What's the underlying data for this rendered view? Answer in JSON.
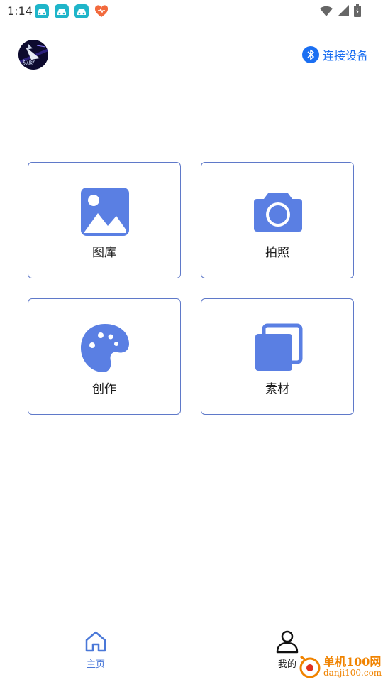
{
  "status_bar": {
    "time": "1:14",
    "notification_icons": [
      "car-app-icon",
      "car-app-icon",
      "car-app-icon",
      "heart-app-icon"
    ],
    "right_icons": [
      "wifi-icon",
      "signal-icon",
      "battery-icon"
    ]
  },
  "header": {
    "avatar_text": "初窗",
    "connect_label": "连接设备",
    "connect_icon": "bluetooth-icon"
  },
  "grid": {
    "items": [
      {
        "label": "图库",
        "icon": "gallery-icon"
      },
      {
        "label": "拍照",
        "icon": "camera-icon"
      },
      {
        "label": "创作",
        "icon": "palette-icon"
      },
      {
        "label": "素材",
        "icon": "copy-icon"
      }
    ]
  },
  "tabbar": {
    "tabs": [
      {
        "label": "主页",
        "icon": "home-icon",
        "active": true
      },
      {
        "label": "我的",
        "icon": "person-icon",
        "active": false
      }
    ]
  },
  "watermark": {
    "cn": "单机100网",
    "en": "danji100.com"
  },
  "colors": {
    "accent": "#5a7fe3",
    "link": "#1b6ff2",
    "card_border": "#5f79c9",
    "tab_active": "#4a78d8",
    "watermark": "#f08300"
  }
}
